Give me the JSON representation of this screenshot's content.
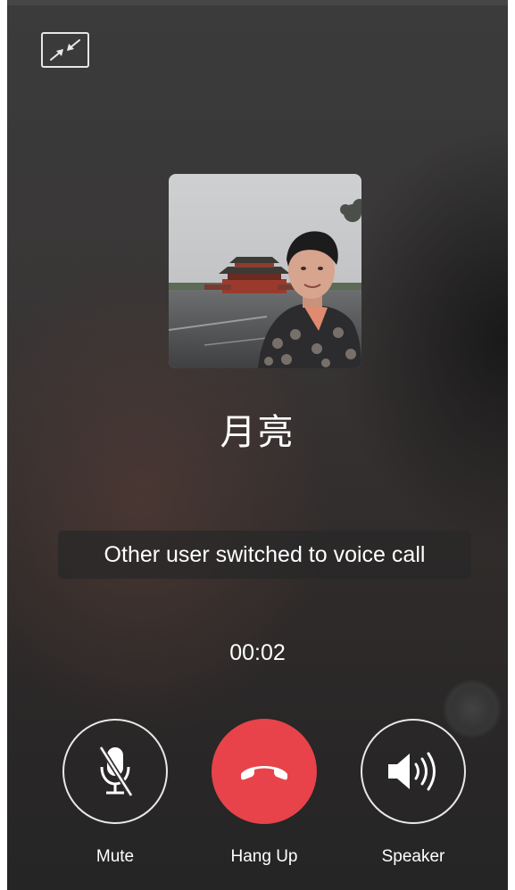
{
  "call": {
    "caller_name": "月亮",
    "status_notice": "Other user switched to voice call",
    "duration": "00:02"
  },
  "controls": {
    "mute_label": "Mute",
    "hangup_label": "Hang Up",
    "speaker_label": "Speaker"
  },
  "icons": {
    "minimize": "minimize-arrows-icon",
    "mute": "microphone-off-icon",
    "hangup": "phone-handset-icon",
    "speaker": "speaker-volume-icon"
  },
  "colors": {
    "hangup": "#e8434a",
    "background": "#333131",
    "foreground": "#ffffff"
  }
}
